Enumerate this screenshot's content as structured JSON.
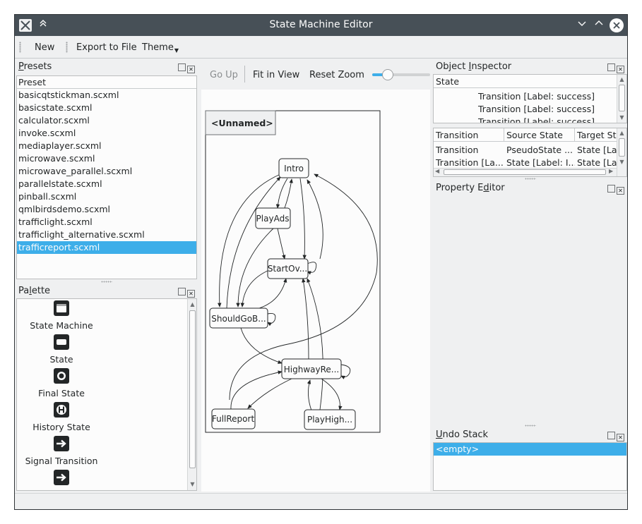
{
  "window": {
    "title": "State Machine Editor"
  },
  "toolbar": {
    "new_label": "New",
    "export_label": "Export to File",
    "theme_label": "Theme"
  },
  "presets": {
    "title_first": "P",
    "title_rest": "resets",
    "header": "Preset",
    "items": [
      "basicqtstickman.scxml",
      "basicstate.scxml",
      "calculator.scxml",
      "invoke.scxml",
      "mediaplayer.scxml",
      "microwave.scxml",
      "microwave_parallel.scxml",
      "parallelstate.scxml",
      "pinball.scxml",
      "qmlbirdsdemo.scxml",
      "trafficlight.scxml",
      "trafficlight_alternative.scxml",
      "trafficreport.scxml"
    ],
    "selected": "trafficreport.scxml"
  },
  "palette": {
    "title_first": "Pa",
    "title_u": "l",
    "title_rest": "ette",
    "items": [
      {
        "label": "State Machine",
        "icon": "state-machine-icon"
      },
      {
        "label": "State",
        "icon": "state-icon"
      },
      {
        "label": "Final State",
        "icon": "final-state-icon"
      },
      {
        "label": "History State",
        "icon": "history-state-icon"
      },
      {
        "label": "Signal Transition",
        "icon": "signal-transition-icon"
      },
      {
        "label": "",
        "icon": "transition-icon"
      }
    ]
  },
  "center_toolbar": {
    "go_up": "Go Up",
    "fit_in_view": "Fit in View",
    "reset_zoom": "Reset Zoom",
    "zoom_level": 0.27
  },
  "diagram": {
    "root_label": "<Unnamed>",
    "states": [
      {
        "id": "intro",
        "label": "Intro"
      },
      {
        "id": "playads",
        "label": "PlayAds"
      },
      {
        "id": "startover",
        "label": "StartOv..."
      },
      {
        "id": "shouldgoback",
        "label": "ShouldGoB..."
      },
      {
        "id": "highwayreport",
        "label": "HighwayRe..."
      },
      {
        "id": "fullreport",
        "label": "FullReport"
      },
      {
        "id": "playhighway",
        "label": "PlayHigh..."
      }
    ]
  },
  "object_inspector": {
    "title_first": "Object ",
    "title_u": "I",
    "title_rest": "nspector",
    "header": "State",
    "rows": [
      "Transition [Label: success]",
      "Transition [Label: success]",
      "Transition [Label: success]"
    ]
  },
  "transition_table": {
    "headers": [
      "Transition",
      "Source State",
      "Target St"
    ],
    "rows": [
      [
        "Transition",
        "PseudoState ...",
        "State [Lab"
      ],
      [
        "Transition [La...",
        "State [Label: I...",
        "State [Lab"
      ]
    ]
  },
  "property_editor": {
    "title_first": "Property E",
    "title_u": "d",
    "title_rest": "itor"
  },
  "undo_stack": {
    "title_first": "U",
    "title_rest": "ndo Stack",
    "items": [
      "<empty>"
    ]
  },
  "colors": {
    "titlebar": "#475057",
    "selection": "#3daee9",
    "window_bg": "#eff0f1"
  }
}
